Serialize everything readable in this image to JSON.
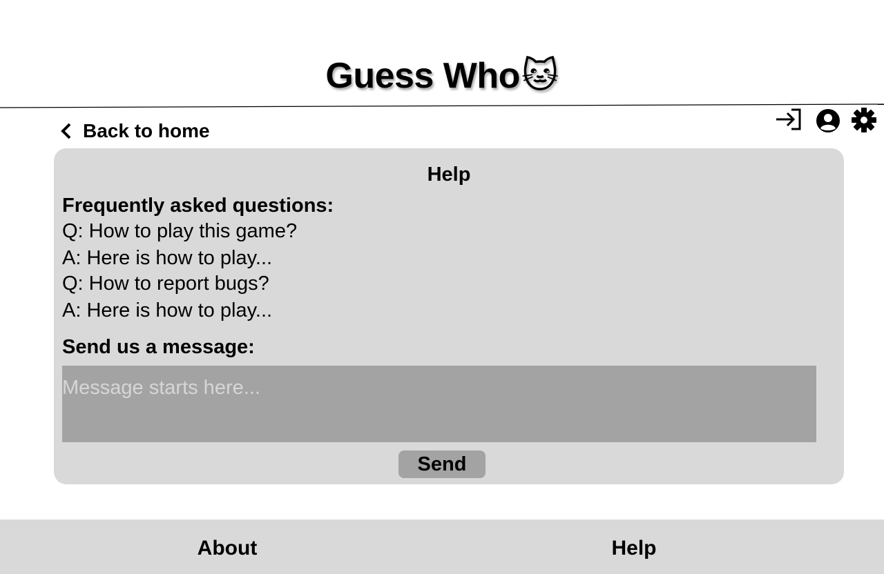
{
  "header": {
    "title": "Guess Who",
    "title_emoji": "🐱"
  },
  "top_icons": [
    {
      "name": "login-icon"
    },
    {
      "name": "account-icon"
    },
    {
      "name": "gear-icon"
    }
  ],
  "nav": {
    "back_label": "Back to home"
  },
  "help_panel": {
    "title": "Help",
    "faq_heading": "Frequently asked questions:",
    "faq": [
      "Q: How to play this game?",
      "A: Here is how to play...",
      "Q: How to report bugs?",
      "A: Here is how to play..."
    ],
    "message_heading": "Send us a message:",
    "message_value": "",
    "message_placeholder": "Message starts here...",
    "send_label": "Send"
  },
  "footer": {
    "about_label": "About",
    "help_label": "Help"
  },
  "colors": {
    "panel_bg": "#d9d9d9",
    "input_bg": "#a3a3a3",
    "footer_bg": "#d9d9d9",
    "text": "#000000",
    "placeholder": "#d6d6d6"
  }
}
